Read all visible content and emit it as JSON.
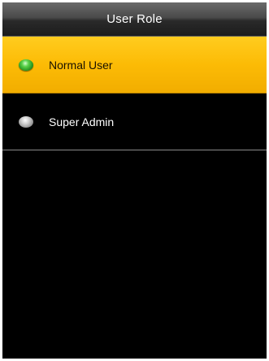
{
  "header": {
    "title": "User Role"
  },
  "options": [
    {
      "label": "Normal User",
      "selected": true
    },
    {
      "label": "Super Admin",
      "selected": false
    }
  ],
  "colors": {
    "selected_background": "#fcbb05",
    "screen_background": "#000000",
    "selected_radio": "#2eaa2a",
    "unselected_radio": "#a0a0a0"
  }
}
